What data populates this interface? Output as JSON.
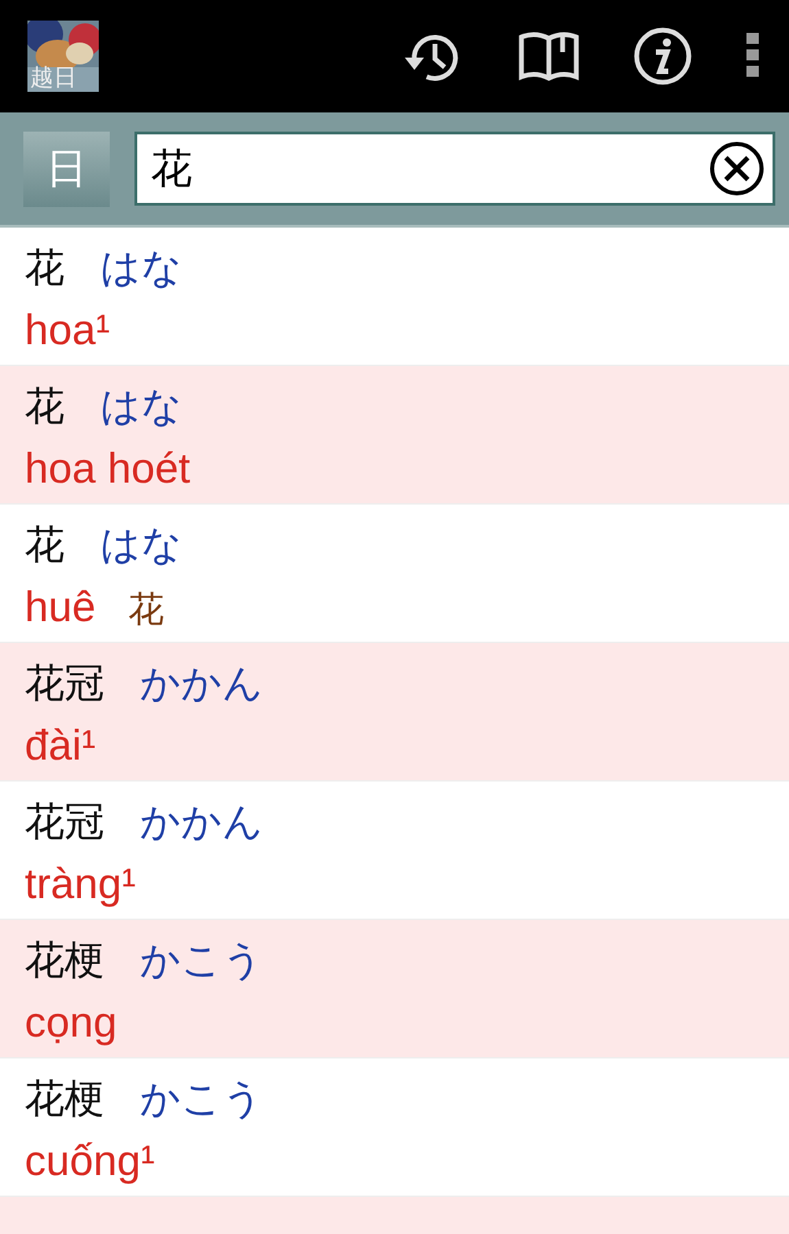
{
  "app_bar": {
    "logo_label": "越日",
    "actions": [
      {
        "kind": "history"
      },
      {
        "kind": "book"
      },
      {
        "kind": "info"
      },
      {
        "kind": "overflow"
      }
    ]
  },
  "search": {
    "mode_button": "日",
    "value": "花"
  },
  "results": [
    {
      "headword": "花",
      "reading": "はな",
      "meaning": "hoa¹"
    },
    {
      "headword": "花",
      "reading": "はな",
      "meaning": "hoa hoét"
    },
    {
      "headword": "花",
      "reading": "はな",
      "meaning": "huê",
      "note": "花"
    },
    {
      "headword": "花冠",
      "reading": "かかん",
      "meaning": "đài¹"
    },
    {
      "headword": "花冠",
      "reading": "かかん",
      "meaning": "tràng¹"
    },
    {
      "headword": "花梗",
      "reading": "かこう",
      "meaning": "cọng"
    },
    {
      "headword": "花梗",
      "reading": "かこう",
      "meaning": "cuống¹"
    }
  ]
}
